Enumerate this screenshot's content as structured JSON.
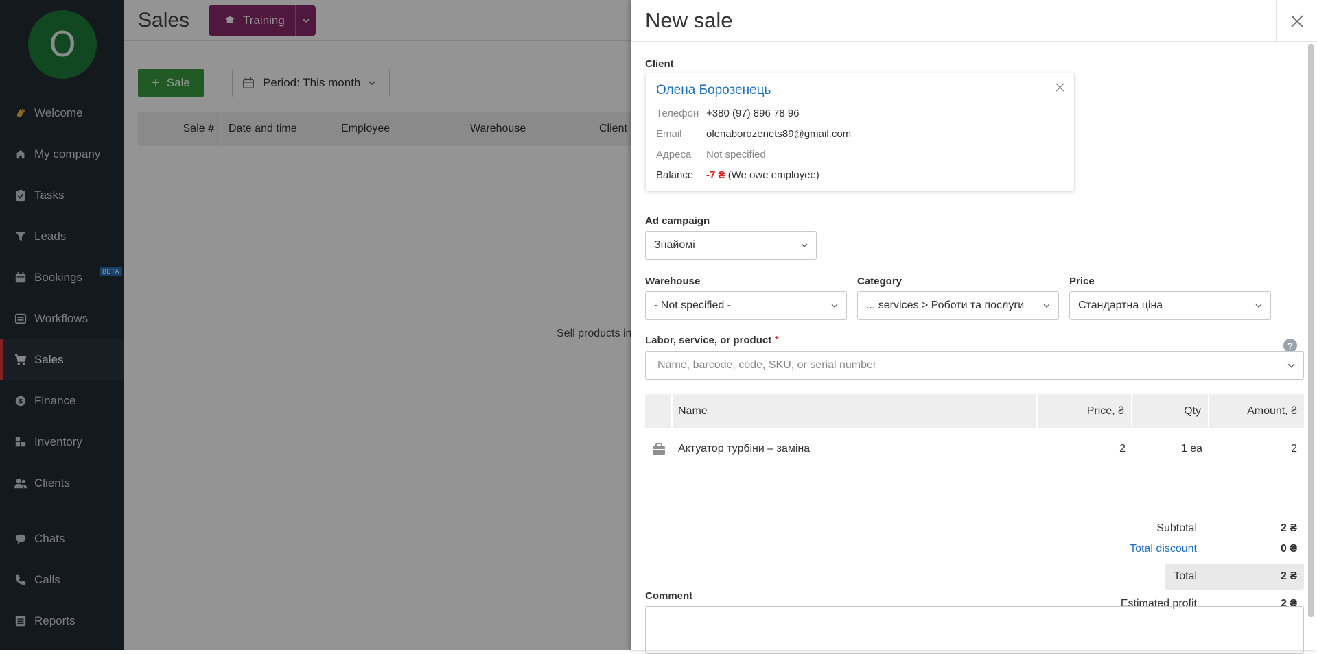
{
  "sidebar": {
    "avatar_letter": "O",
    "items": [
      {
        "label": "Welcome",
        "icon": "wave-hand-icon"
      },
      {
        "label": "My company",
        "icon": "home-icon"
      },
      {
        "label": "Tasks",
        "icon": "clipboard-check-icon"
      },
      {
        "label": "Leads",
        "icon": "funnel-icon"
      },
      {
        "label": "Bookings",
        "icon": "calendar-icon",
        "badge": "BETA"
      },
      {
        "label": "Workflows",
        "icon": "monitor-icon"
      },
      {
        "label": "Sales",
        "icon": "cart-icon"
      },
      {
        "label": "Finance",
        "icon": "dollar-circle-icon"
      },
      {
        "label": "Inventory",
        "icon": "boxes-icon"
      },
      {
        "label": "Clients",
        "icon": "users-icon"
      },
      {
        "label": "Chats",
        "icon": "chat-bubble-icon"
      },
      {
        "label": "Calls",
        "icon": "phone-icon"
      },
      {
        "label": "Reports",
        "icon": "list-report-icon"
      }
    ]
  },
  "main": {
    "title": "Sales",
    "training_label": "Training",
    "sale_button": "Sale",
    "period_label": "Period: This month",
    "columns": [
      "Sale #",
      "Date and time",
      "Employee",
      "Warehouse",
      "Client"
    ],
    "empty_text": "Sell products in"
  },
  "panel": {
    "title": "New sale",
    "client_label": "Client",
    "client": {
      "name": "Олена Борозенець",
      "phone_label": "Телефон",
      "phone": "+380 (97) 896 78 96",
      "email_label": "Email",
      "email": "olenaborozenets89@gmail.com",
      "address_label": "Адреса",
      "address": "Not specified",
      "balance_label": "Balance",
      "balance_value": "-7 ₴",
      "balance_note": "(We owe employee)"
    },
    "ad_campaign_label": "Ad campaign",
    "ad_campaign_value": "Знайомі",
    "warehouse_label": "Warehouse",
    "warehouse_value": "- Not specified -",
    "category_label": "Category",
    "category_value": "... services > Роботи та послуги",
    "price_label": "Price",
    "price_value": "Стандартна ціна",
    "product_label": "Labor, service, or product",
    "product_required": "*",
    "product_placeholder": "Name, barcode, code, SKU, or serial number",
    "table": {
      "headers": {
        "name": "Name",
        "price": "Price, ₴",
        "qty": "Qty",
        "amount": "Amount, ₴"
      },
      "rows": [
        {
          "name": "Актуатор турбіни – заміна",
          "price": "2",
          "qty": "1 ea",
          "amount": "2",
          "icon": "toolbox-icon"
        }
      ]
    },
    "totals": {
      "subtotal_label": "Subtotal",
      "subtotal": "2 ₴",
      "discount_label": "Total discount",
      "discount": "0 ₴",
      "total_label": "Total",
      "total": "2 ₴",
      "profit_label": "Estimated profit",
      "profit": "2 ₴"
    },
    "comment_label": "Comment"
  },
  "colors": {
    "sidebar_bg": "#222b33",
    "accent_red": "#e03a3e",
    "link_blue": "#1b6fc2",
    "sale_green": "#3a9b3e",
    "training_purple": "#8c2a6a"
  }
}
